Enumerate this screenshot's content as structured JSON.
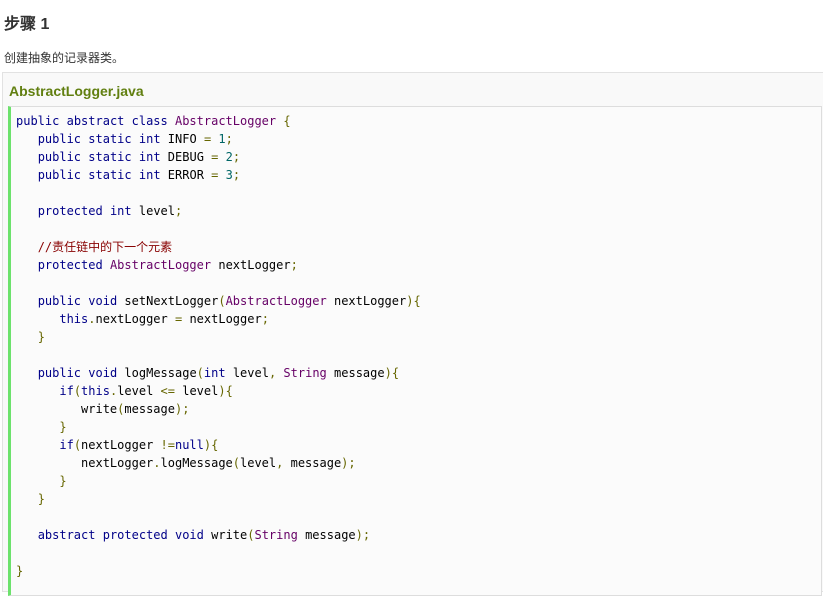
{
  "step": {
    "title": "步骤 1",
    "description": "创建抽象的记录器类。"
  },
  "example": {
    "file_name": "AbstractLogger.java",
    "code_lines": [
      "public abstract class AbstractLogger {",
      "   public static int INFO = 1;",
      "   public static int DEBUG = 2;",
      "   public static int ERROR = 3;",
      "",
      "   protected int level;",
      "",
      "   //责任链中的下一个元素",
      "   protected AbstractLogger nextLogger;",
      "",
      "   public void setNextLogger(AbstractLogger nextLogger){",
      "      this.nextLogger = nextLogger;",
      "   }",
      "",
      "   public void logMessage(int level, String message){",
      "      if(this.level <= level){",
      "         write(message);",
      "      }",
      "      if(nextLogger !=null){",
      "         nextLogger.logMessage(level, message);",
      "      }",
      "   }",
      "",
      "   abstract protected void write(String message);",
      "",
      "}"
    ]
  },
  "colors": {
    "keyword": "#000088",
    "plain": "#000000",
    "comment": "#880000",
    "type": "#660066",
    "literal": "#006666",
    "punctuation": "#666600",
    "example_title": "#617f10",
    "code_border_accent": "#6ce26c"
  }
}
